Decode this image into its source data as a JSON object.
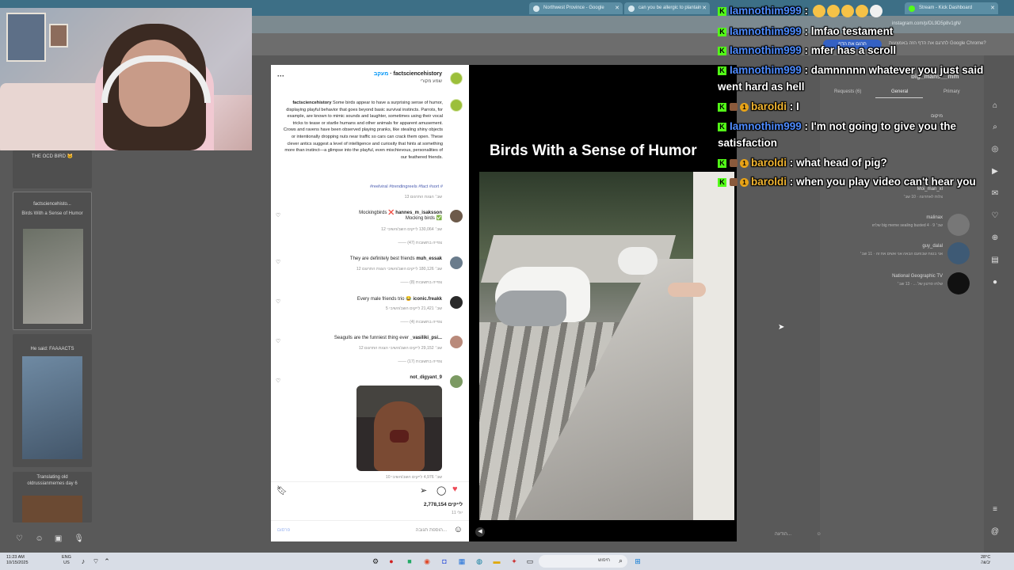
{
  "browser": {
    "tabs": [
      {
        "title": "Northwest Province - Google"
      },
      {
        "title": "can you be allergic to plantain"
      },
      {
        "title": "Stream - Kick Dashboard"
      }
    ],
    "url": "instagram.com/p/DL9D5p8v1gN/",
    "translate_button": "תרגם את הדף",
    "translate_text": "לתרגם את הדף הזה באמצעות Google Chrome?"
  },
  "left_feed": {
    "items": [
      {
        "caption": "THE OCD BIRD 🐱"
      },
      {
        "caption": "factsciencehisto...",
        "subtitle": "Birds With a Sense of Humor"
      },
      {
        "caption": "He said: FAAAACTS"
      },
      {
        "caption": "Translating old",
        "subtitle": "oldrussianmemes day 6"
      }
    ]
  },
  "post": {
    "header_user": "factsciencehistory",
    "header_follow": "מעקב",
    "header_sub": "שמע מקורי",
    "caption_user": "factsciencehistory",
    "caption_text": "Some birds appear to have a surprising sense of humor, displaying playful behavior that goes beyond basic survival instincts. Parrots, for example, are known to mimic sounds and laughter, sometimes using their vocal tricks to tease or startle humans and other animals for apparent amusement. Crows and ravens have been observed playing pranks, like stealing shiny objects or intentionally dropping nuts near traffic so cars can crack them open. These clever antics suggest a level of intelligence and curiosity that hints at something more than instinct—a glimpse into the playful, even mischievous, personalities of our feathered friends.",
    "hashtags": "#reelviral #trendingreels #fact #sort #",
    "caption_meta": "13 שב׳   הצגת התרגום",
    "comments": [
      {
        "user": "hannes_m_isaksson",
        "text": "Mockingbirds ❌",
        "text2": "Mocking birds ✅",
        "meta": "12 שב׳   130,064 לייקים   השב/השיבי",
        "replies": "——  צפייה בתשובות (47)"
      },
      {
        "user": "muh_essak",
        "text": "They are definitely best friends",
        "meta": "12 שב׳   180,126 לייקים   השב/השיבי   הצגת התרגום",
        "replies": "——  צפייה בתשובות (8)"
      },
      {
        "user": "iconic.freakk",
        "text": "Every male friends trio 😂",
        "meta": "5 שב׳   21,421 לייקים   השב/השיבי",
        "replies": "——  צפייה בתשובות (4)"
      },
      {
        "user": "_vasiliki_psi...",
        "text": "Seagulls are the funniest thing ever",
        "meta": "12 שב׳   29,152 לייקים   השב/השיבי   הצגת התרגום",
        "replies": "——  צפייה בתשובות (17)"
      },
      {
        "user": "not_digyant_9",
        "text": "",
        "meta": "10 שב׳   4,976 לייקים   השב/השיבי",
        "replies": ""
      }
    ],
    "likes": "2,778,154 לייקים",
    "date": "11 יולי",
    "comment_placeholder": "הוספת תגובה...",
    "post_button": "פרסום"
  },
  "video": {
    "title": "Birds With a Sense of Humor"
  },
  "dm": {
    "username": "big_mans__mm",
    "tabs": [
      "Primary",
      "General",
      "Requests (6)"
    ],
    "threads": [
      {
        "name": "מיקום",
        "msg": ""
      },
      {
        "name": "Moi_man_xl",
        "msg": "צלות לאחרונה · 10 שב׳"
      },
      {
        "name": "malinax",
        "msg": "שלחו big meme sealing busted 4 · 9 שב׳"
      },
      {
        "name": "guy_dalal",
        "msg": "אני בטוח שבפעם הבאה אני אשים את זה · 11 שב׳"
      },
      {
        "name": "National Geographic TV",
        "msg": "שלחו סרטון של ... · 13 שב׳"
      }
    ],
    "compose": "הודעה..."
  },
  "chat": {
    "lines": [
      {
        "user": "Iamnothim999",
        "color": "#4f8cff",
        "message": "",
        "emotes": 5,
        "badge_sub": false
      },
      {
        "user": "Iamnothim999",
        "color": "#4f8cff",
        "message": "lmfao testament",
        "emotes": 0,
        "badge_sub": false
      },
      {
        "user": "Iamnothim999",
        "color": "#4f8cff",
        "message": "mfer has a scroll",
        "emotes": 0,
        "badge_sub": false
      },
      {
        "user": "Iamnothim999",
        "color": "#4f8cff",
        "message": "damnnnnn whatever you just said went hard as hell",
        "emotes": 0,
        "badge_sub": false
      },
      {
        "user": "baroldi",
        "color": "#f2b632",
        "message": "I",
        "emotes": 0,
        "badge_sub": true
      },
      {
        "user": "Iamnothim999",
        "color": "#4f8cff",
        "message": "I'm not going to give you the satisfaction",
        "emotes": 0,
        "badge_sub": false
      },
      {
        "user": "baroldi",
        "color": "#f2b632",
        "message": "what head of pig?",
        "emotes": 0,
        "badge_sub": true
      },
      {
        "user": "baroldi",
        "color": "#f2b632",
        "message": "when you play video can't hear you",
        "emotes": 0,
        "badge_sub": true
      }
    ],
    "sub_badge_number": "1",
    "kick_badge": "K"
  },
  "taskbar": {
    "time": "11:23 AM",
    "date": "10/15/2025",
    "lang": "ENG",
    "region": "US",
    "search_text": "חיפוש",
    "weather_temp": "28°C",
    "weather_desc": "יבשה"
  },
  "colors": {
    "chat_user_blue": "#4f8cff",
    "chat_user_gold": "#f2b632",
    "kick_green": "#53fc18",
    "like_red": "#ed4956"
  }
}
